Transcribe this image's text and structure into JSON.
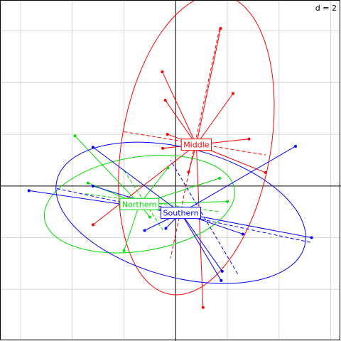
{
  "scale_label": "d = 2",
  "chart_data": {
    "type": "scatter",
    "title": "",
    "grid": true,
    "grid_step": 1,
    "xlim": [
      -3.4,
      3.2
    ],
    "ylim": [
      -3.0,
      3.6
    ],
    "groups": [
      {
        "name": "Middle",
        "color": "#ff0000",
        "center": [
          0.4,
          0.8
        ],
        "ellipse": {
          "rx": 1.44,
          "ry": 2.94,
          "rotation_deg": 10
        },
        "axis_ends": [
          [
            0.85,
            3.05
          ],
          [
            -0.1,
            -1.4
          ],
          [
            -1.0,
            1.05
          ],
          [
            1.75,
            0.6
          ]
        ],
        "points": [
          [
            0.87,
            3.05
          ],
          [
            -0.26,
            2.21
          ],
          [
            -0.2,
            1.66
          ],
          [
            1.11,
            1.79
          ],
          [
            -0.16,
            1.0
          ],
          [
            1.42,
            0.91
          ],
          [
            -0.25,
            0.73
          ],
          [
            1.74,
            0.26
          ],
          [
            0.25,
            0.27
          ],
          [
            -1.6,
            -0.75
          ],
          [
            0.53,
            -2.35
          ]
        ]
      },
      {
        "name": "Northern",
        "color": "#00dd00",
        "center": [
          -0.7,
          -0.35
        ],
        "ellipse": {
          "rx": 1.86,
          "ry": 0.91,
          "rotation_deg": -9
        },
        "axis_ends": [
          [
            -1.0,
            0.3
          ],
          [
            -0.25,
            -0.85
          ],
          [
            -1.75,
            -0.15
          ],
          [
            0.85,
            -0.5
          ]
        ],
        "points": [
          [
            -1.95,
            0.97
          ],
          [
            -1.7,
            0.06
          ],
          [
            -0.15,
            0.35
          ],
          [
            0.85,
            0.15
          ],
          [
            1.0,
            -0.3
          ],
          [
            -0.5,
            -0.6
          ],
          [
            -1.0,
            -1.25
          ]
        ]
      },
      {
        "name": "Southern",
        "color": "#0000ff",
        "center": [
          0.1,
          -0.52
        ],
        "ellipse": {
          "rx": 2.48,
          "ry": 1.25,
          "rotation_deg": 15
        },
        "axis_ends": [
          [
            -2.3,
            -0.05
          ],
          [
            2.65,
            -1.1
          ],
          [
            1.2,
            -1.7
          ],
          [
            -0.1,
            0.5
          ]
        ],
        "points": [
          [
            2.32,
            0.77
          ],
          [
            -2.84,
            -0.09
          ],
          [
            -1.6,
            0.0
          ],
          [
            -1.6,
            0.75
          ],
          [
            1.3,
            -0.93
          ],
          [
            2.63,
            -1.0
          ],
          [
            -0.6,
            -0.86
          ],
          [
            -0.19,
            -0.82
          ],
          [
            0.9,
            -1.65
          ],
          [
            0.88,
            -1.83
          ]
        ]
      }
    ]
  }
}
